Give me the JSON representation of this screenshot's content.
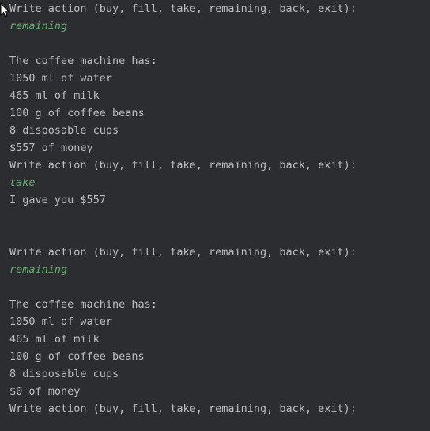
{
  "console": {
    "lines": [
      {
        "text": "Write action (buy, fill, take, remaining, back, exit):",
        "kind": "output"
      },
      {
        "text": "remaining",
        "kind": "input"
      },
      {
        "text": "",
        "kind": "blank"
      },
      {
        "text": "The coffee machine has:",
        "kind": "output"
      },
      {
        "text": "1050 ml of water",
        "kind": "output"
      },
      {
        "text": "465 ml of milk",
        "kind": "output"
      },
      {
        "text": "100 g of coffee beans",
        "kind": "output"
      },
      {
        "text": "8 disposable cups",
        "kind": "output"
      },
      {
        "text": "$557 of money",
        "kind": "output"
      },
      {
        "text": "Write action (buy, fill, take, remaining, back, exit):",
        "kind": "output"
      },
      {
        "text": "take",
        "kind": "input"
      },
      {
        "text": "I gave you $557",
        "kind": "output"
      },
      {
        "text": "",
        "kind": "blank"
      },
      {
        "text": "",
        "kind": "blank"
      },
      {
        "text": "Write action (buy, fill, take, remaining, back, exit):",
        "kind": "output"
      },
      {
        "text": "remaining",
        "kind": "input"
      },
      {
        "text": "",
        "kind": "blank"
      },
      {
        "text": "The coffee machine has:",
        "kind": "output"
      },
      {
        "text": "1050 ml of water",
        "kind": "output"
      },
      {
        "text": "465 ml of milk",
        "kind": "output"
      },
      {
        "text": "100 g of coffee beans",
        "kind": "output"
      },
      {
        "text": "8 disposable cups",
        "kind": "output"
      },
      {
        "text": "$0 of money",
        "kind": "output"
      },
      {
        "text": "Write action (buy, fill, take, remaining, back, exit):",
        "kind": "output"
      }
    ]
  },
  "colors": {
    "background": "#2b2d30",
    "output_text": "#bcbec4",
    "input_text": "#6aab73"
  },
  "icons": {
    "cursor": "mouse-pointer-icon"
  }
}
